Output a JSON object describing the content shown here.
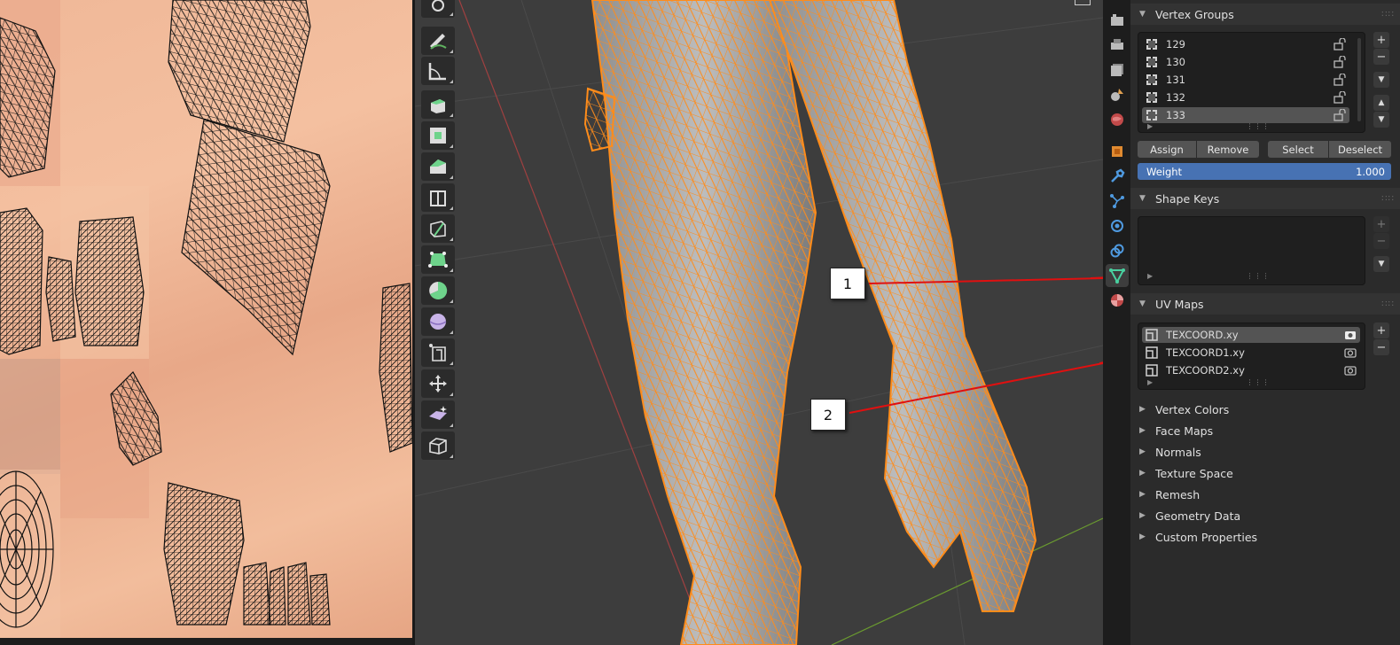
{
  "callouts": {
    "one": "1",
    "two": "2"
  },
  "vertex_groups": {
    "title": "Vertex Groups",
    "items": [
      "129",
      "130",
      "131",
      "132",
      "133"
    ],
    "selected_index": 4,
    "assign_label": "Assign",
    "remove_label": "Remove",
    "select_label": "Select",
    "deselect_label": "Deselect",
    "weight_label": "Weight",
    "weight_value": "1.000"
  },
  "shape_keys": {
    "title": "Shape Keys"
  },
  "uv_maps": {
    "title": "UV Maps",
    "items": [
      "TEXCOORD.xy",
      "TEXCOORD1.xy",
      "TEXCOORD2.xy"
    ],
    "selected_index": 0
  },
  "collapsed_panels": [
    "Vertex Colors",
    "Face Maps",
    "Normals",
    "Texture Space",
    "Remesh",
    "Geometry Data",
    "Custom Properties"
  ],
  "icons": {
    "toolbar": [
      "cursor-icon",
      "annotate-icon",
      "measure-icon",
      "extrude-region-icon",
      "inset-faces-icon",
      "bevel-icon",
      "loop-cut-icon",
      "knife-icon",
      "poly-build-icon",
      "spin-icon",
      "smooth-icon",
      "edge-slide-icon",
      "shrink-fatten-icon",
      "shear-icon",
      "rip-region-icon"
    ],
    "property_tabs": [
      "render-icon",
      "output-icon",
      "view-layer-icon",
      "scene-icon",
      "world-icon",
      "object-icon",
      "modifier-icon",
      "particles-icon",
      "physics-icon",
      "constraints-icon",
      "object-data-icon",
      "material-icon"
    ]
  },
  "colors": {
    "accent": "#4772b3",
    "mesh": "#ff8c1a",
    "arrow": "#e01010",
    "data_tab": "#49d1a0"
  }
}
